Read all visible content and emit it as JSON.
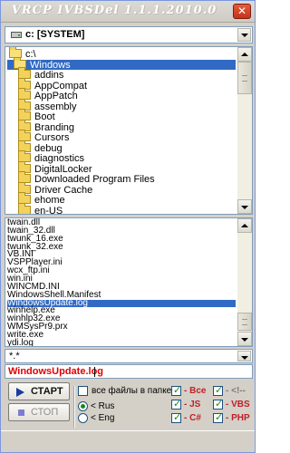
{
  "window": {
    "title": "VRCP IVBSDel 1.1.1.2010.0",
    "close_icon": "close-icon"
  },
  "drive": {
    "value": "c: [SYSTEM]"
  },
  "folders": {
    "items": [
      {
        "label": "c:\\",
        "icon": "open-folder-icon",
        "indent": 0,
        "selected": false
      },
      {
        "label": "Windows",
        "icon": "open-folder-icon",
        "indent": 1,
        "selected": true
      },
      {
        "label": "addins",
        "icon": "folder-icon",
        "indent": 2,
        "selected": false
      },
      {
        "label": "AppCompat",
        "icon": "folder-icon",
        "indent": 2,
        "selected": false
      },
      {
        "label": "AppPatch",
        "icon": "folder-icon",
        "indent": 2,
        "selected": false
      },
      {
        "label": "assembly",
        "icon": "folder-icon",
        "indent": 2,
        "selected": false
      },
      {
        "label": "Boot",
        "icon": "folder-icon",
        "indent": 2,
        "selected": false
      },
      {
        "label": "Branding",
        "icon": "folder-icon",
        "indent": 2,
        "selected": false
      },
      {
        "label": "Cursors",
        "icon": "folder-icon",
        "indent": 2,
        "selected": false
      },
      {
        "label": "debug",
        "icon": "folder-icon",
        "indent": 2,
        "selected": false
      },
      {
        "label": "diagnostics",
        "icon": "folder-icon",
        "indent": 2,
        "selected": false
      },
      {
        "label": "DigitalLocker",
        "icon": "folder-icon",
        "indent": 2,
        "selected": false
      },
      {
        "label": "Downloaded Program Files",
        "icon": "folder-icon",
        "indent": 2,
        "selected": false
      },
      {
        "label": "Driver Cache",
        "icon": "folder-icon",
        "indent": 2,
        "selected": false
      },
      {
        "label": "ehome",
        "icon": "folder-icon",
        "indent": 2,
        "selected": false
      },
      {
        "label": "en-US",
        "icon": "folder-icon",
        "indent": 2,
        "selected": false
      }
    ]
  },
  "files": {
    "items": [
      {
        "label": "twain.dll",
        "selected": false
      },
      {
        "label": "twain_32.dll",
        "selected": false
      },
      {
        "label": "twunk_16.exe",
        "selected": false
      },
      {
        "label": "twunk_32.exe",
        "selected": false
      },
      {
        "label": "VB.INI",
        "selected": false
      },
      {
        "label": "VSPPlayer.ini",
        "selected": false
      },
      {
        "label": "wcx_ftp.ini",
        "selected": false
      },
      {
        "label": "win.ini",
        "selected": false
      },
      {
        "label": "WINCMD.INI",
        "selected": false
      },
      {
        "label": "WindowsShell.Manifest",
        "selected": false
      },
      {
        "label": "WindowsUpdate.log",
        "selected": true
      },
      {
        "label": "winhelp.exe",
        "selected": false
      },
      {
        "label": "winhlp32.exe",
        "selected": false
      },
      {
        "label": "WMSysPr9.prx",
        "selected": false
      },
      {
        "label": "write.exe",
        "selected": false
      },
      {
        "label": "ydi.log",
        "selected": false
      }
    ]
  },
  "filter": {
    "value": "*.*"
  },
  "filename": {
    "value": "WindowsUpdate.log"
  },
  "controls": {
    "start_label": "СТАРТ",
    "stop_label": "СТОП",
    "all_files_label": "все файлы в папке",
    "rus_label": "< Rus",
    "eng_label": "< Eng",
    "all_label": "- Все",
    "js_label": "- JS",
    "csharp_label": "- C#",
    "comment_label": "- <!--",
    "vbs_label": "- VBS",
    "php_label": "- PHP",
    "all_files_checked": false,
    "rus_selected": true,
    "eng_selected": false,
    "all_checked": true,
    "js_checked": true,
    "csharp_checked": true,
    "comment_checked": true,
    "vbs_checked": true,
    "php_checked": true
  },
  "colors": {
    "selection": "#316ac5",
    "accent_red": "#c0202a",
    "filename_red": "#e00000"
  }
}
